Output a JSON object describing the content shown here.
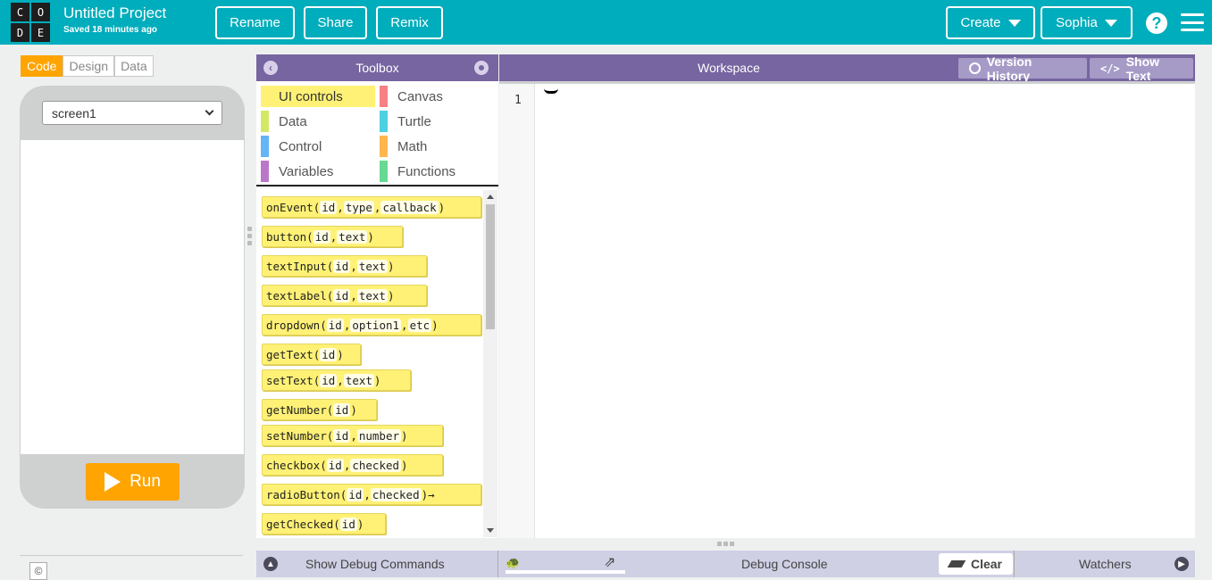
{
  "header": {
    "logo_letters": [
      "C",
      "O",
      "D",
      "E"
    ],
    "project_title": "Untitled Project",
    "saved_status": "Saved 18 minutes ago",
    "rename_label": "Rename",
    "share_label": "Share",
    "remix_label": "Remix",
    "create_label": "Create",
    "user_label": "Sophia",
    "help_icon": "?"
  },
  "mode_tabs": [
    "Code",
    "Design",
    "Data"
  ],
  "active_mode": "Code",
  "app_preview": {
    "screen_selected": "screen1",
    "run_label": "Run",
    "copyright_symbol": "©"
  },
  "toolbox": {
    "title": "Toolbox",
    "categories": [
      {
        "label": "UI controls",
        "color": "#fff176"
      },
      {
        "label": "Canvas",
        "color": "#f78183"
      },
      {
        "label": "Data",
        "color": "#d3e965"
      },
      {
        "label": "Turtle",
        "color": "#4dd0e1"
      },
      {
        "label": "Control",
        "color": "#64b5f6"
      },
      {
        "label": "Math",
        "color": "#ffb74d"
      },
      {
        "label": "Variables",
        "color": "#bb77c7"
      },
      {
        "label": "Functions",
        "color": "#68d995"
      }
    ],
    "selected_category": "UI controls",
    "blocks": [
      {
        "fn": "onEvent",
        "params": [
          "id",
          "type",
          "callback"
        ]
      },
      {
        "fn": "button",
        "params": [
          "id",
          "text"
        ]
      },
      {
        "fn": "textInput",
        "params": [
          "id",
          "text"
        ]
      },
      {
        "fn": "textLabel",
        "params": [
          "id",
          "text"
        ]
      },
      {
        "fn": "dropdown",
        "params": [
          "id",
          "option1",
          "etc"
        ]
      },
      {
        "fn": "getText",
        "params": [
          "id"
        ]
      },
      {
        "fn": "setText",
        "params": [
          "id",
          "text"
        ]
      },
      {
        "fn": "getNumber",
        "params": [
          "id"
        ]
      },
      {
        "fn": "setNumber",
        "params": [
          "id",
          "number"
        ]
      },
      {
        "fn": "checkbox",
        "params": [
          "id",
          "checked"
        ]
      },
      {
        "fn": "radioButton",
        "params": [
          "id",
          "checked"
        ],
        "suffix": " →"
      },
      {
        "fn": "getChecked",
        "params": [
          "id"
        ]
      }
    ]
  },
  "workspace": {
    "title": "Workspace",
    "version_history_label": "Version History",
    "show_text_label": "Show Text",
    "line_numbers": [
      "1"
    ]
  },
  "debug": {
    "show_commands_label": "Show Debug Commands",
    "console_label": "Debug Console",
    "clear_label": "Clear",
    "watchers_label": "Watchers"
  }
}
